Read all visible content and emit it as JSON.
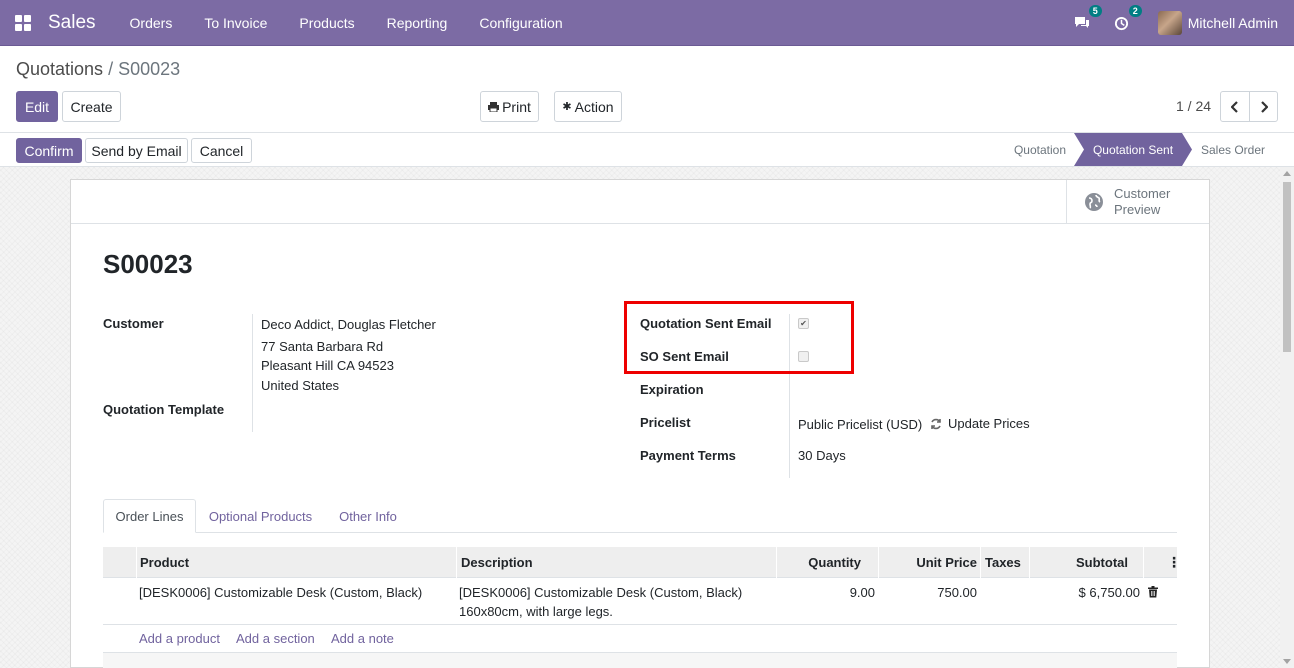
{
  "navbar": {
    "app_name": "Sales",
    "menu": [
      "Orders",
      "To Invoice",
      "Products",
      "Reporting",
      "Configuration"
    ],
    "messages_count": "5",
    "activities_count": "2",
    "user_name": "Mitchell Admin",
    "accent_color": "#7c6ba4"
  },
  "breadcrumb": {
    "parent": "Quotations",
    "separator": "/",
    "current": "S00023"
  },
  "control": {
    "edit_label": "Edit",
    "create_label": "Create",
    "print_label": "Print",
    "action_label": "Action",
    "pager": "1 / 24"
  },
  "statusbar": {
    "confirm_label": "Confirm",
    "send_email_label": "Send by Email",
    "cancel_label": "Cancel",
    "stages": [
      "Quotation",
      "Quotation Sent",
      "Sales Order"
    ],
    "active_stage": "Quotation Sent"
  },
  "sheet": {
    "preview_label_1": "Customer",
    "preview_label_2": "Preview",
    "name": "S00023",
    "customer_label": "Customer",
    "customer_name": "Deco Addict, Douglas Fletcher",
    "address_1": "77 Santa Barbara Rd",
    "address_2": "Pleasant Hill CA 94523",
    "address_3": "United States",
    "template_label": "Quotation Template",
    "quotation_sent_email_label": "Quotation Sent Email",
    "quotation_sent_email_checked": true,
    "so_sent_email_label": "SO Sent Email",
    "so_sent_email_checked": false,
    "expiration_label": "Expiration",
    "pricelist_label": "Pricelist",
    "pricelist_value": "Public Pricelist (USD)",
    "update_prices_label": "Update Prices",
    "payment_terms_label": "Payment Terms",
    "payment_terms_value": "30 Days"
  },
  "tabs": [
    "Order Lines",
    "Optional Products",
    "Other Info"
  ],
  "table": {
    "headers": {
      "product": "Product",
      "description": "Description",
      "quantity": "Quantity",
      "unit_price": "Unit Price",
      "taxes": "Taxes",
      "subtotal": "Subtotal"
    },
    "row": {
      "product": "[DESK0006] Customizable Desk (Custom, Black)",
      "description_1": "[DESK0006] Customizable Desk (Custom, Black)",
      "description_2": "160x80cm, with large legs.",
      "quantity": "9.00",
      "unit_price": "750.00",
      "taxes": "",
      "subtotal": "$ 6,750.00"
    },
    "add_product": "Add a product",
    "add_section": "Add a section",
    "add_note": "Add a note"
  }
}
